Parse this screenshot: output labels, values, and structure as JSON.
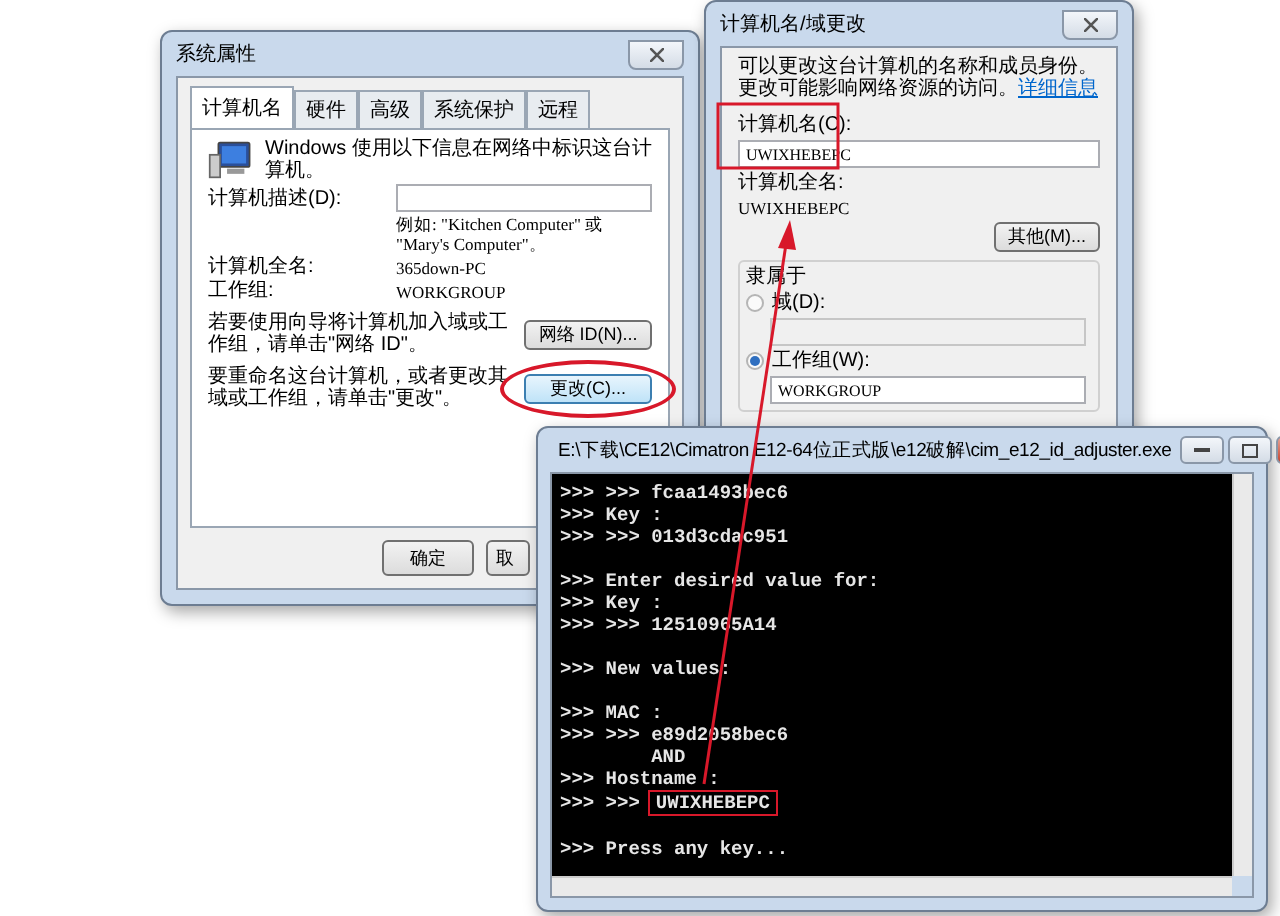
{
  "system_properties": {
    "title": "系统属性",
    "tabs": [
      {
        "label": "计算机名",
        "selected": true
      },
      {
        "label": "硬件",
        "selected": false
      },
      {
        "label": "高级",
        "selected": false
      },
      {
        "label": "系统保护",
        "selected": false
      },
      {
        "label": "远程",
        "selected": false
      }
    ],
    "intro": "Windows 使用以下信息在网络中标识这台计算机。",
    "description_label": "计算机描述(D):",
    "example": "例如: \"Kitchen Computer\" 或 \"Mary's Computer\"。",
    "fields": [
      {
        "label": "计算机全名:",
        "value": "365down-PC"
      },
      {
        "label": "工作组:",
        "value": "WORKGROUP"
      }
    ],
    "actions": [
      {
        "text": "若要使用向导将计算机加入域或工作组，请单击\"网络 ID\"。",
        "button": "网络 ID(N)...",
        "circled": false
      },
      {
        "text": "要重命名这台计算机，或者更改其域或工作组，请单击\"更改\"。",
        "button": "更改(C)...",
        "circled": true
      }
    ],
    "buttons": [
      "确定",
      "取"
    ]
  },
  "name_dialog": {
    "title": "计算机名/域更改",
    "intro": "可以更改这台计算机的名称和成员身份。更改可能影响网络资源的访问。",
    "link": "详细信息",
    "name_label": "计算机名(C):",
    "name_value": "UWIXHEBEPC",
    "full_name_label": "计算机全名:",
    "full_name_value": "UWIXHEBEPC",
    "more_button": "其他(M)...",
    "member_of": {
      "label": "隶属于",
      "options": [
        {
          "label": "域(D):",
          "selected": false,
          "field": {
            "disabled": true
          }
        },
        {
          "label": "工作组(W):",
          "selected": true,
          "field": {
            "value": "WORKGROUP",
            "disabled": false
          }
        }
      ]
    }
  },
  "console": {
    "title": "E:\\下载\\CE12\\Cimatron E12-64位正式版\\e12破解\\cim_e12_id_adjuster.exe",
    "blocks": [
      [
        {
          "kind": "plain",
          "text": ">>> >>> fcaa1493bec6"
        },
        {
          "kind": "plain",
          "text": ">>> Key :"
        },
        {
          "kind": "plain",
          "text": ">>> >>> 013d3cdac951"
        }
      ],
      [
        {
          "kind": "plain",
          "text": ">>> Enter desired value for:"
        },
        {
          "kind": "plain",
          "text": ">>> Key :"
        },
        {
          "kind": "plain",
          "text": ">>> >>> 12510965A14"
        }
      ],
      [
        {
          "kind": "plain",
          "text": ">>> New values:"
        }
      ],
      [
        {
          "kind": "plain",
          "text": ">>> MAC :"
        },
        {
          "kind": "plain",
          "text": ">>> >>> e89d2058bec6"
        },
        {
          "kind": "plain",
          "text": "        AND"
        },
        {
          "kind": "plain",
          "text": ">>> Hostname :"
        },
        {
          "kind": "boxed",
          "text": ">>> >>>",
          "value": "UWIXHEBEPC"
        }
      ],
      [
        {
          "kind": "plain",
          "text": ">>> Press any key..."
        }
      ]
    ]
  }
}
